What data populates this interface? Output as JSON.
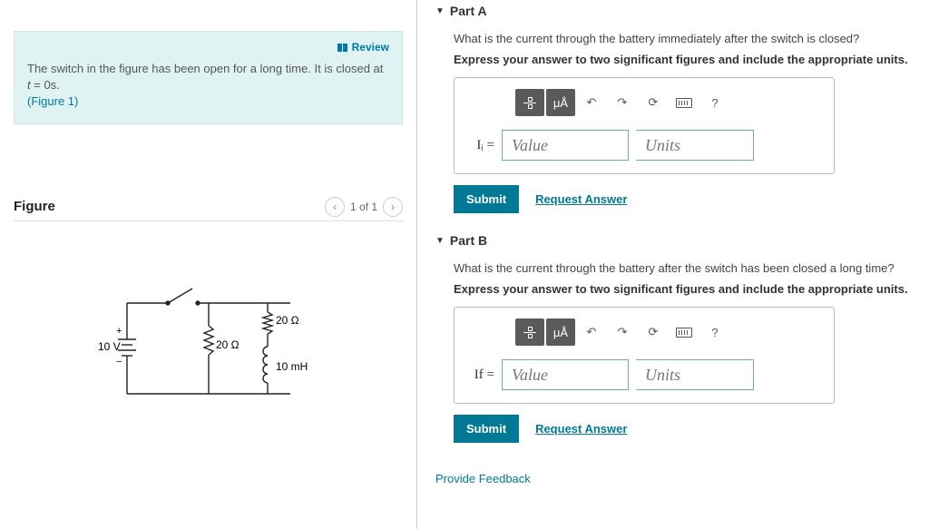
{
  "problem": {
    "review_label": "Review",
    "intro_a": "The switch in the figure has been open for a long time. It is closed at ",
    "intro_var": "t",
    "intro_b": " = 0s.",
    "figlink": "(Figure 1)"
  },
  "figure": {
    "heading": "Figure",
    "nav_label": "1 of 1",
    "labels": {
      "v": "10 V",
      "r1": "20 Ω",
      "r2": "20 Ω",
      "l": "10 mH"
    }
  },
  "partA": {
    "title": "Part A",
    "q": "What is the current through the battery immediately after the switch is closed?",
    "instr": "Express your answer to two significant figures and include the appropriate units.",
    "var": "Iᵢ =",
    "val_ph": "Value",
    "unit_ph": "Units"
  },
  "partB": {
    "title": "Part B",
    "q": "What is the current through the battery after the switch has been closed a long time?",
    "instr": "Express your answer to two significant figures and include the appropriate units.",
    "var": "If =",
    "val_ph": "Value",
    "unit_ph": "Units"
  },
  "common": {
    "submit": "Submit",
    "request": "Request Answer",
    "mu": "μÅ",
    "help": "?",
    "undo": "↶",
    "redo": "↷",
    "reset": "⟳"
  },
  "feedback": "Provide Feedback"
}
